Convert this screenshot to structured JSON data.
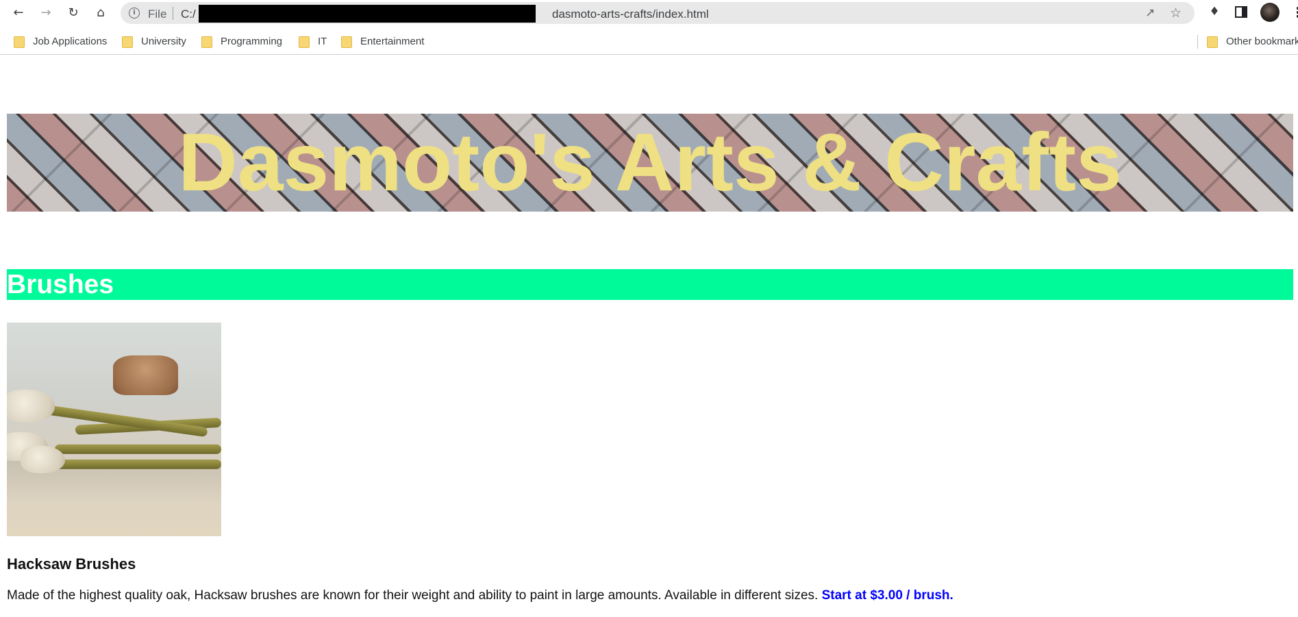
{
  "browser": {
    "address_bar": {
      "scheme_label": "File",
      "url_prefix": "C:/",
      "url_path": "dasmoto-arts-crafts/index.html"
    },
    "icons": {
      "back": "back-arrow-icon",
      "forward": "forward-arrow-icon",
      "reload": "reload-icon",
      "home": "home-icon",
      "info": "info-icon",
      "share": "share-icon",
      "bookmark_star": "star-icon",
      "extensions": "puzzle-piece-icon",
      "side_panel": "side-panel-icon",
      "menu": "kebab-menu-icon"
    },
    "bookmarks": [
      {
        "label": "Job Applications"
      },
      {
        "label": "University"
      },
      {
        "label": "Programming"
      },
      {
        "label": "IT"
      },
      {
        "label": "Entertainment"
      }
    ],
    "other_bookmarks": "Other bookmarks"
  },
  "page": {
    "banner_title": "Dasmoto's Arts & Crafts",
    "section_heading": "Brushes",
    "product": {
      "title": "Hacksaw Brushes",
      "description": "Made of the highest quality oak, Hacksaw brushes are known for their weight and ability to paint in large amounts. Available in different sizes.",
      "price": "Start at $3.00 / brush."
    }
  },
  "colors": {
    "banner_text": "#efe083",
    "section_header_bg": "#00fa9a",
    "section_header_text": "#ffffff",
    "price_text": "#0000ff"
  }
}
